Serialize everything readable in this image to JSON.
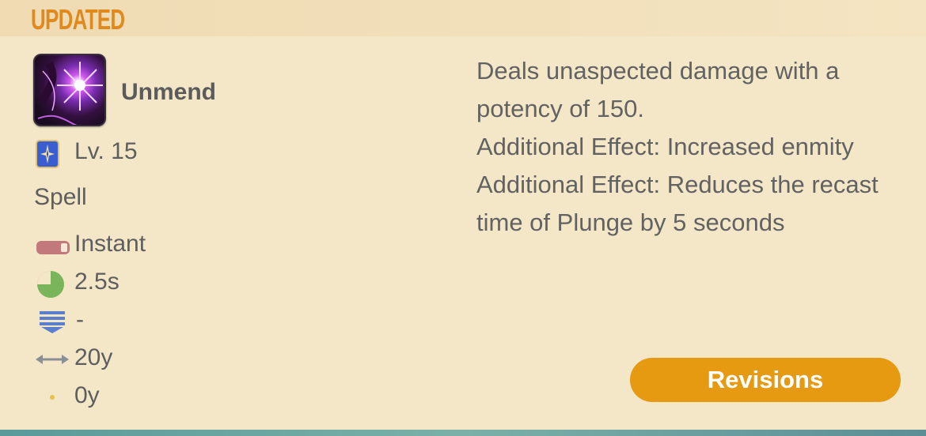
{
  "header": {
    "status_label": "UPDATED"
  },
  "action": {
    "name": "Unmend",
    "level": "Lv. 15",
    "type": "Spell",
    "cast": "Instant",
    "recast": "2.5s",
    "cost": "-",
    "range": "20y",
    "radius": "0y"
  },
  "description": {
    "lines": [
      "Deals unaspected damage with a potency of 150.",
      "Additional Effect: Increased enmity",
      "Additional Effect: Reduces the recast time of Plunge by 5 seconds"
    ]
  },
  "buttons": {
    "revisions_label": "Revisions"
  },
  "icons": {
    "action": "unmend-action-icon",
    "job": "dark-knight-job-icon",
    "cast": "cast-bar-icon",
    "recast": "recast-pie-icon",
    "cost": "mp-cost-icon",
    "range": "range-arrow-icon",
    "radius": "radius-dot-icon"
  },
  "colors": {
    "background": "#f3e7c8",
    "updated_label": "#e08a1e",
    "button": "#e59a12",
    "cast_icon": "#c3797c",
    "recast_icon": "#7ab55c",
    "mp_icon": "#5a7fce"
  }
}
